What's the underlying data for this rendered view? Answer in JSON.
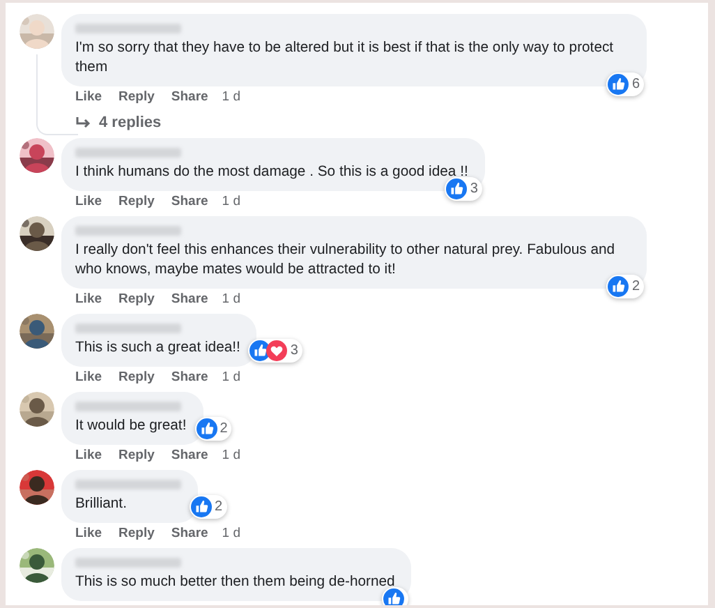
{
  "comments": [
    {
      "text": "I'm so sorry that they have to be altered but it is best if that is the only way to protect them",
      "avatar": {
        "kind": "picture"
      },
      "reactions": [
        {
          "kind": "like"
        }
      ],
      "reaction_count": "6",
      "actions": [
        "Like",
        "Reply",
        "Share"
      ],
      "time": "1 d",
      "replies": "4 replies"
    },
    {
      "text": "I think humans do the most damage . So this is a good idea !!",
      "avatar": {
        "kind": "picture"
      },
      "reactions": [
        {
          "kind": "like"
        }
      ],
      "reaction_count": "3",
      "actions": [
        "Like",
        "Reply",
        "Share"
      ],
      "time": "1 d"
    },
    {
      "text": "I really don't feel this enhances their vulnerability to other natural prey. Fabulous and who knows, maybe mates would be attracted to it!",
      "avatar": {
        "kind": "picture"
      },
      "reactions": [
        {
          "kind": "like"
        }
      ],
      "reaction_count": "2",
      "actions": [
        "Like",
        "Reply",
        "Share"
      ],
      "time": "1 d"
    },
    {
      "text": "This is such a great idea!!",
      "avatar": {
        "kind": "picture"
      },
      "reactions": [
        {
          "kind": "like"
        },
        {
          "kind": "love"
        }
      ],
      "reaction_count": "3",
      "actions": [
        "Like",
        "Reply",
        "Share"
      ],
      "time": "1 d"
    },
    {
      "text": "It would be great!",
      "avatar": {
        "kind": "picture"
      },
      "reactions": [
        {
          "kind": "like"
        }
      ],
      "reaction_count": "2",
      "actions": [
        "Like",
        "Reply",
        "Share"
      ],
      "time": "1 d"
    },
    {
      "text": "Brilliant.",
      "avatar": {
        "kind": "picture"
      },
      "reactions": [
        {
          "kind": "like"
        }
      ],
      "reaction_count": "2",
      "actions": [
        "Like",
        "Reply",
        "Share"
      ],
      "time": "1 d"
    },
    {
      "text": "This is so much better then them being de-horned",
      "avatar": {
        "kind": "picture"
      },
      "reactions": [
        {
          "kind": "like"
        }
      ]
    }
  ]
}
